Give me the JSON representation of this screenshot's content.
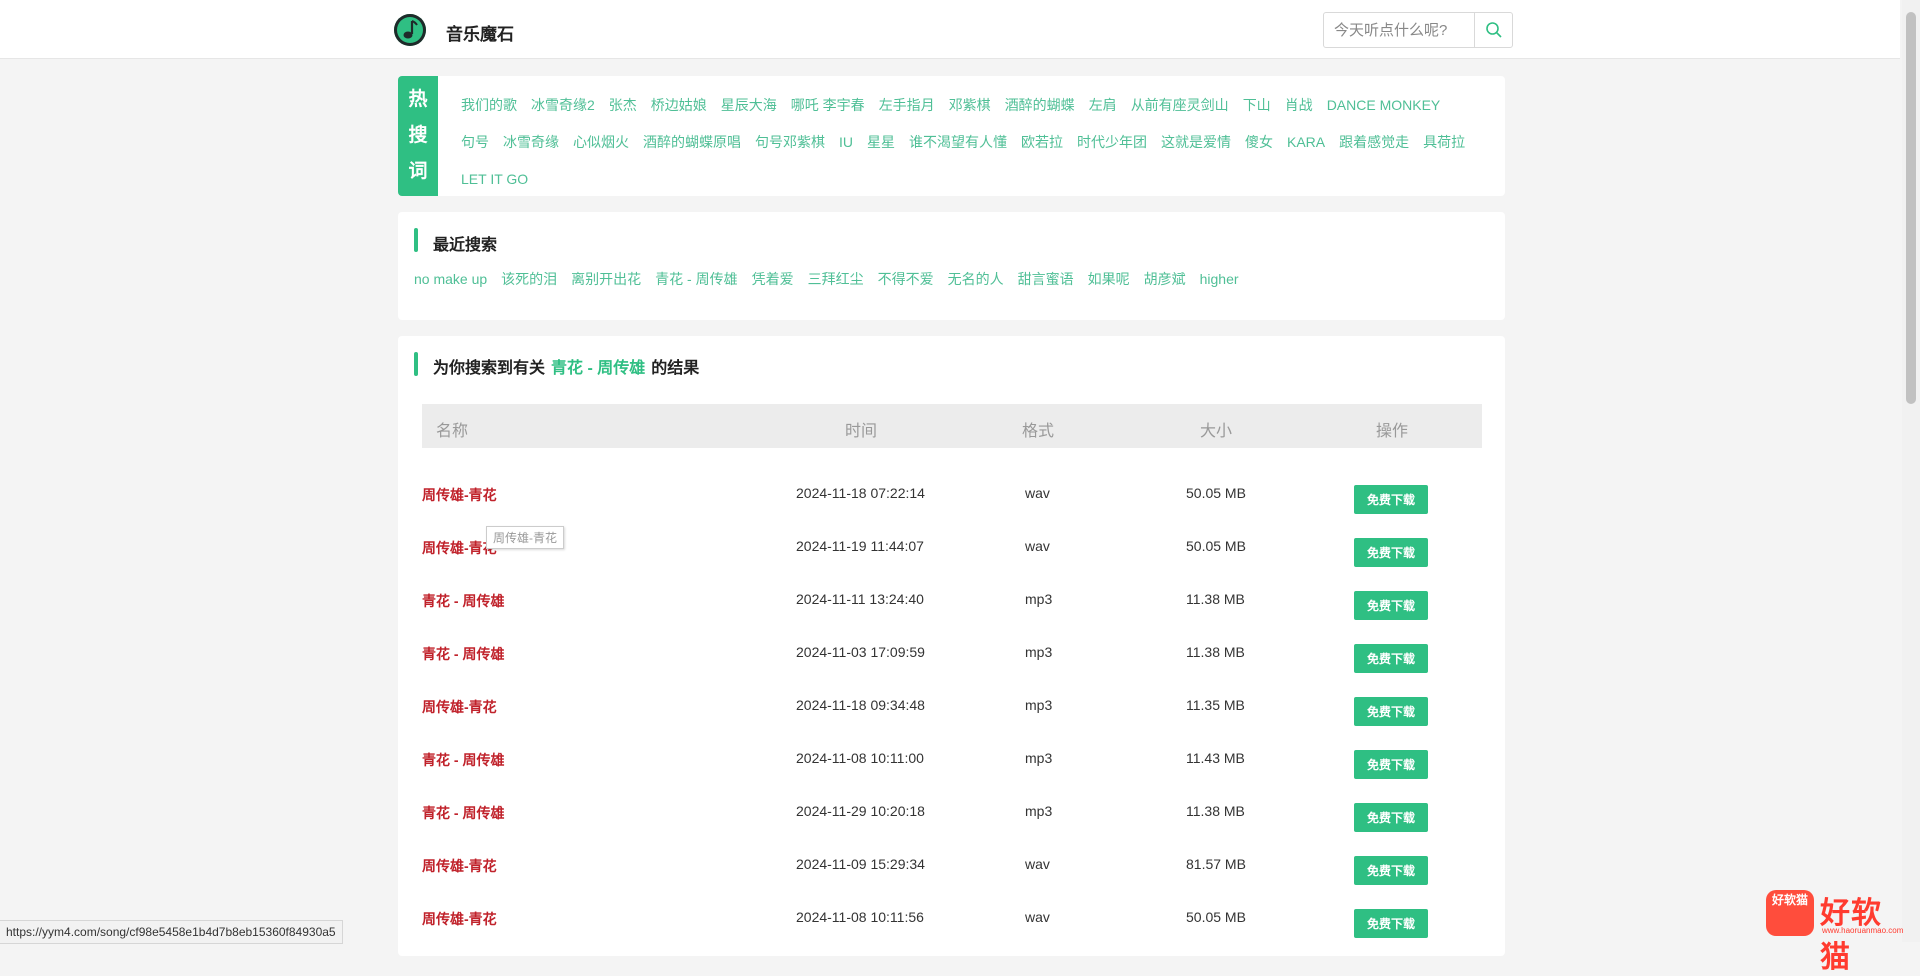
{
  "header": {
    "brand": "音乐魔石",
    "search_placeholder": "今天听点什么呢?",
    "search_icon": "search-icon",
    "logo_icon": "music-note-icon"
  },
  "hot": {
    "label": [
      "热",
      "搜",
      "词"
    ],
    "items": [
      "我们的歌",
      "冰雪奇缘2",
      "张杰",
      "桥边姑娘",
      "星辰大海",
      "哪吒 李宇春",
      "左手指月",
      "邓紫棋",
      "酒醉的蝴蝶",
      "左肩",
      "从前有座灵剑山",
      "下山",
      "肖战",
      "DANCE MONKEY",
      "句号",
      "冰雪奇缘",
      "心似烟火",
      "酒醉的蝴蝶原唱",
      "句号邓紫棋",
      "IU",
      "星星",
      "谁不渴望有人懂",
      "欧若拉",
      "时代少年团",
      "这就是爱情",
      "傻女",
      "KARA",
      "跟着感觉走",
      "具荷拉",
      "LET IT GO"
    ]
  },
  "recent": {
    "title": "最近搜索",
    "items": [
      "no make up",
      "该死的泪",
      "离别开出花",
      "青花 - 周传雄",
      "凭着爱",
      "三拜红尘",
      "不得不爱",
      "无名的人",
      "甜言蜜语",
      "如果呢",
      "胡彦斌",
      "higher"
    ]
  },
  "results": {
    "prefix": "为你搜索到有关",
    "keyword": "青花 - 周传雄",
    "suffix": "的结果",
    "columns": {
      "name": "名称",
      "time": "时间",
      "format": "格式",
      "size": "大小",
      "action": "操作"
    },
    "download_label": "免费下载",
    "rows": [
      {
        "name": "周传雄-青花",
        "time": "2024-11-18 07:22:14",
        "format": "wav",
        "size": "50.05 MB"
      },
      {
        "name": "周传雄-青花",
        "time": "2024-11-19 11:44:07",
        "format": "wav",
        "size": "50.05 MB"
      },
      {
        "name": "青花 - 周传雄",
        "time": "2024-11-11 13:24:40",
        "format": "mp3",
        "size": "11.38 MB"
      },
      {
        "name": "青花 - 周传雄",
        "time": "2024-11-03 17:09:59",
        "format": "mp3",
        "size": "11.38 MB"
      },
      {
        "name": "周传雄-青花",
        "time": "2024-11-18 09:34:48",
        "format": "mp3",
        "size": "11.35 MB"
      },
      {
        "name": "青花 - 周传雄",
        "time": "2024-11-08 10:11:00",
        "format": "mp3",
        "size": "11.43 MB"
      },
      {
        "name": "青花 - 周传雄",
        "time": "2024-11-29 10:20:18",
        "format": "mp3",
        "size": "11.38 MB"
      },
      {
        "name": "周传雄-青花",
        "time": "2024-11-09 15:29:34",
        "format": "wav",
        "size": "81.57 MB"
      },
      {
        "name": "周传雄-青花",
        "time": "2024-11-08 10:11:56",
        "format": "wav",
        "size": "50.05 MB"
      }
    ]
  },
  "tooltip": "周传雄-青花",
  "status_url": "https://yym4.com/song/cf98e5458e1b4d7b8eb15360f84930a5",
  "watermark": {
    "badge": "好软猫",
    "text": "好软猫",
    "sub": "www.haoruanmao.com"
  },
  "colors": {
    "accent": "#2fbf83",
    "song_name": "#c0222b",
    "link": "#4fbf96"
  }
}
